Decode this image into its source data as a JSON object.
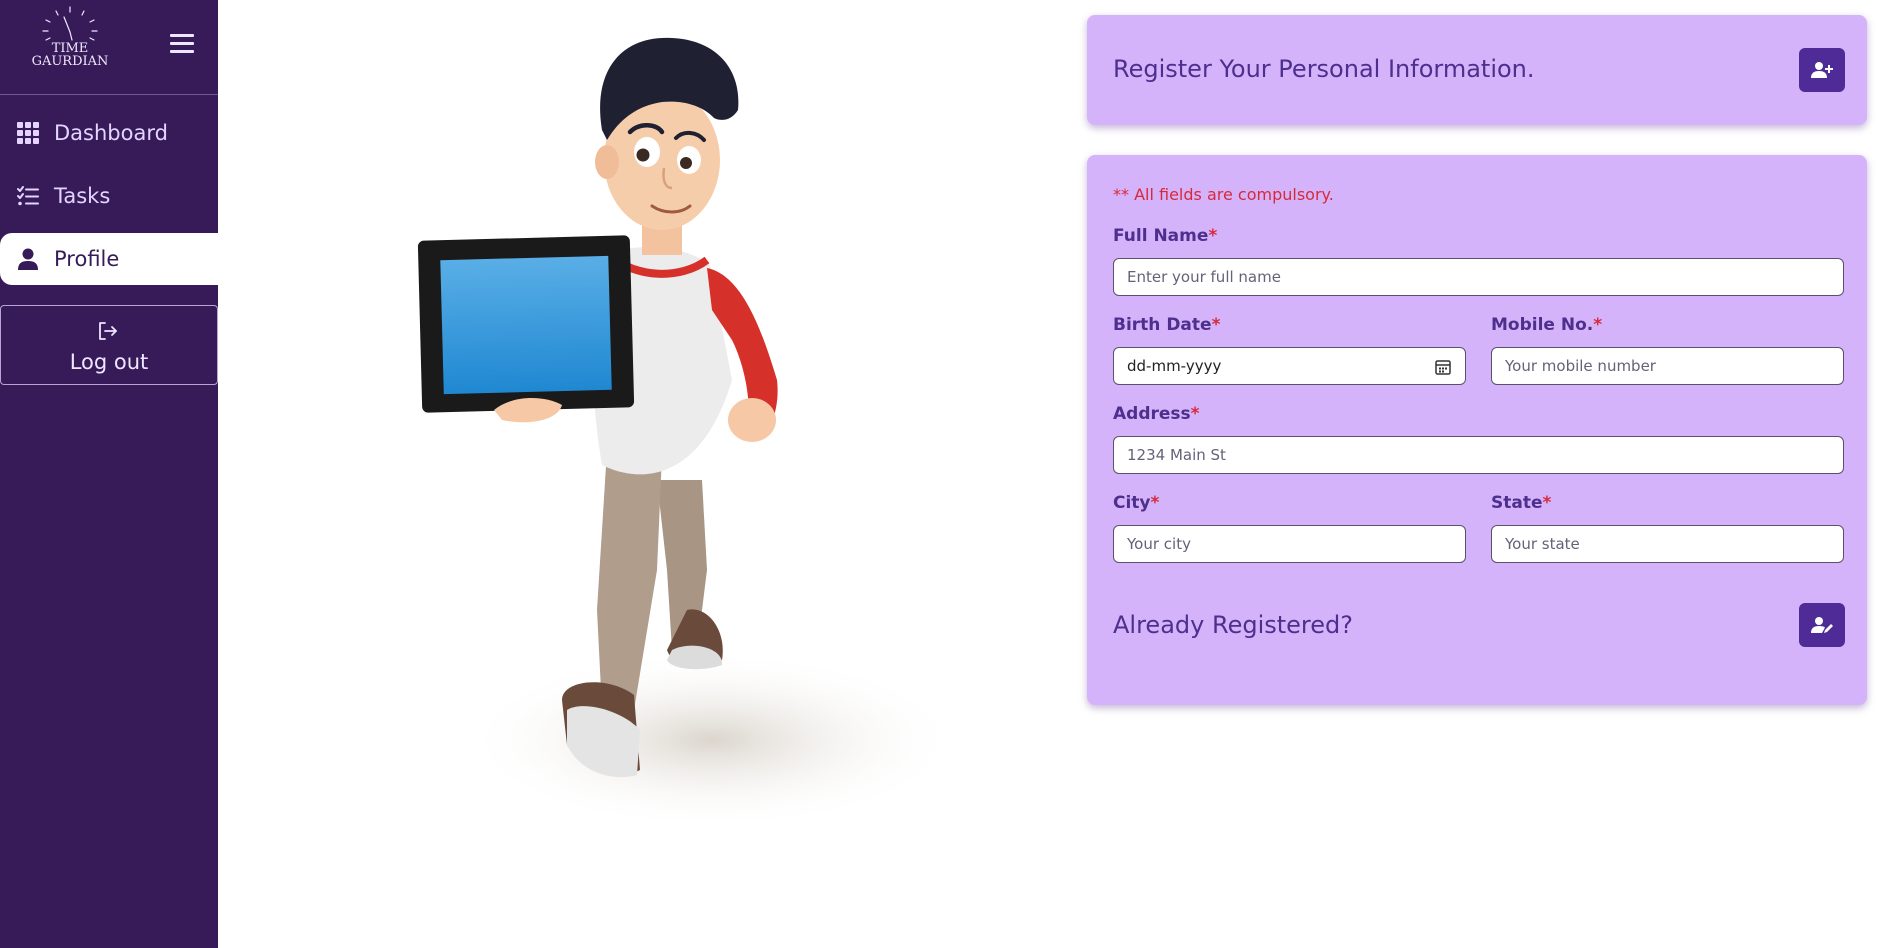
{
  "sidebar": {
    "logo": {
      "line1": "TIME",
      "line2": "GAURDIAN"
    },
    "nav": [
      {
        "label": "Dashboard",
        "icon": "grid-icon"
      },
      {
        "label": "Tasks",
        "icon": "checklist-icon"
      },
      {
        "label": "Profile",
        "icon": "user-icon",
        "active": true
      }
    ],
    "logout_label": "Log out"
  },
  "header": {
    "title": "Register Your Personal Information.",
    "icon": "user-plus-icon"
  },
  "form": {
    "note": "** All fields are compulsory.",
    "required_mark": "*",
    "full_name": {
      "label": "Full Name",
      "placeholder": "Enter your full name",
      "value": ""
    },
    "birth_date": {
      "label": "Birth Date",
      "display": "dd-mm-yyyy"
    },
    "mobile": {
      "label": "Mobile No.",
      "placeholder": "Your mobile number",
      "value": ""
    },
    "address": {
      "label": "Address",
      "placeholder": "1234 Main St",
      "value": ""
    },
    "city": {
      "label": "City",
      "placeholder": "Your city",
      "value": ""
    },
    "state": {
      "label": "State",
      "placeholder": "Your state",
      "value": ""
    },
    "already_registered": {
      "label": "Already Registered?",
      "icon": "user-edit-icon"
    }
  },
  "colors": {
    "sidebar_bg": "#361b58",
    "card_bg": "#d5b3fb",
    "accent": "#4e2b96",
    "required": "#d62a3b"
  }
}
